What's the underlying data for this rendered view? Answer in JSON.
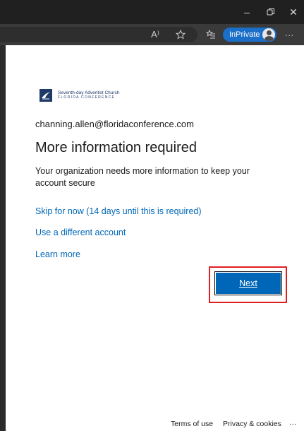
{
  "browser": {
    "window_controls": {
      "minimize": "–",
      "restore": "⧉",
      "close": "✕"
    },
    "toolbar": {
      "read_aloud": "A⁾",
      "inprivate_label": "InPrivate",
      "more": "···"
    }
  },
  "page": {
    "org_name_line1": "Seventh-day Adventist Church",
    "org_name_line2": "FLORIDA CONFERENCE",
    "email": "channing.allen@floridaconference.com",
    "heading": "More information required",
    "description": "Your organization needs more information to keep your account secure",
    "links": {
      "skip": "Skip for now (14 days until this is required)",
      "different_account": "Use a different account",
      "learn_more": "Learn more"
    },
    "next_button": "Next"
  },
  "footer": {
    "terms": "Terms of use",
    "privacy": "Privacy & cookies",
    "more": "···"
  },
  "colors": {
    "link": "#0067b8",
    "primary_button": "#0067b8",
    "highlight_box": "#e02020",
    "inprivate_badge": "#1b6fc9",
    "logo": "#1f3a68"
  }
}
